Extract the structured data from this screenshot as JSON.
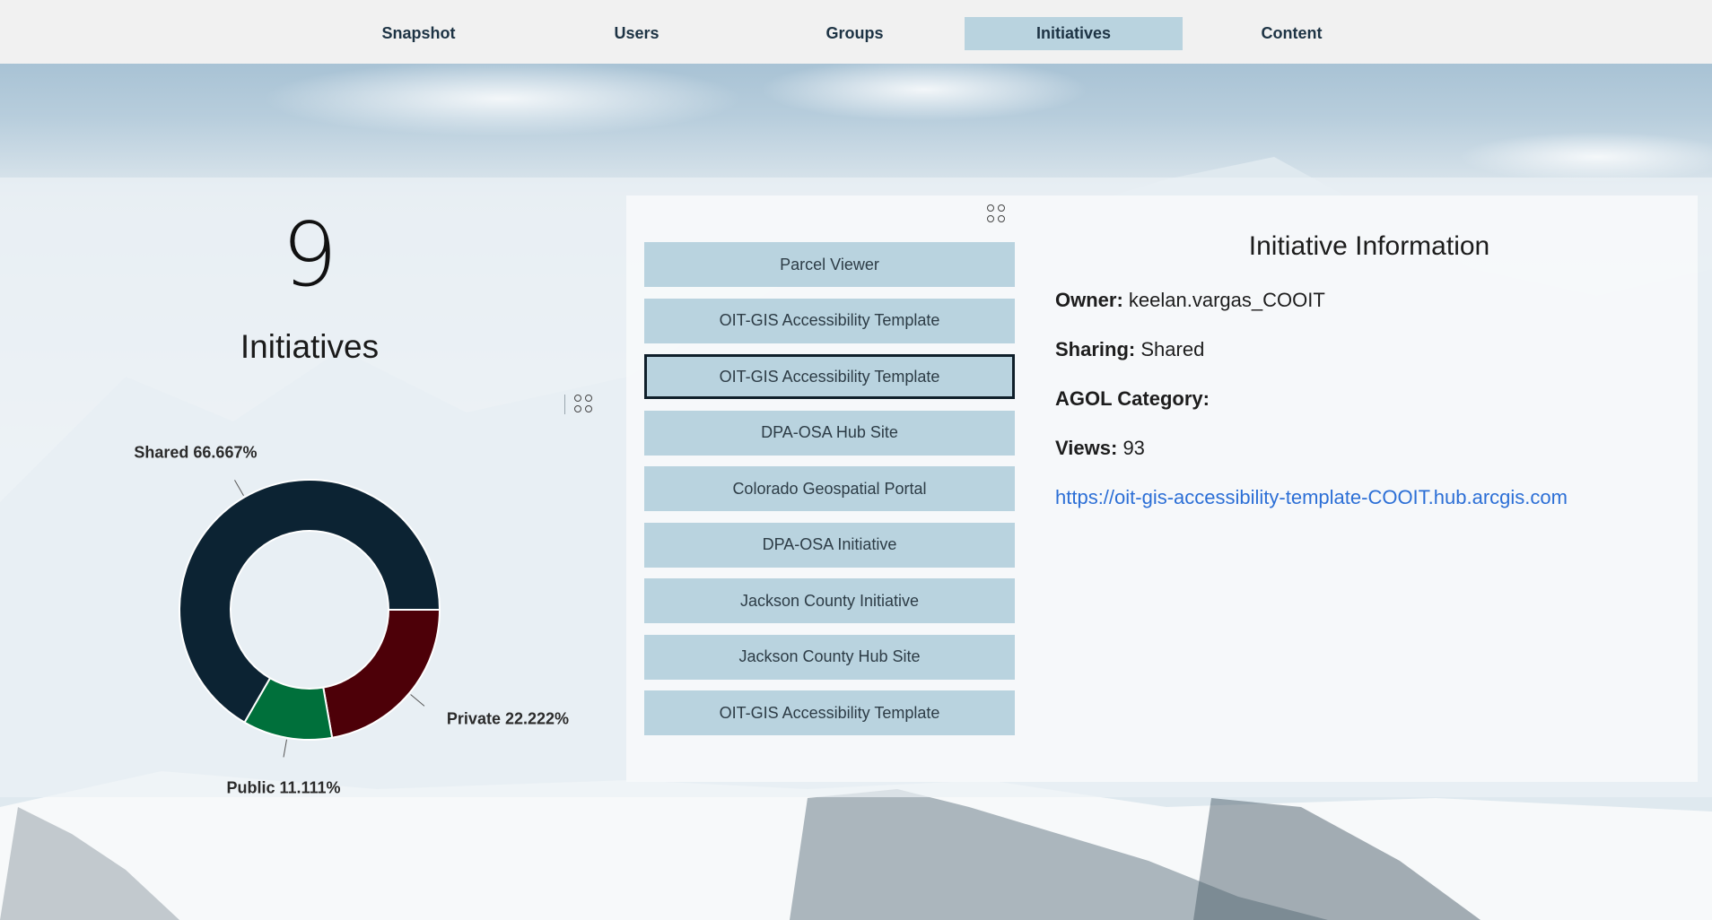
{
  "nav": {
    "items": [
      {
        "label": "Snapshot"
      },
      {
        "label": "Users"
      },
      {
        "label": "Groups"
      },
      {
        "label": "Initiatives"
      },
      {
        "label": "Content"
      }
    ],
    "active": "Initiatives"
  },
  "summary": {
    "count": "9",
    "label": "Initiatives"
  },
  "chart_data": {
    "type": "pie",
    "donut": true,
    "categories": [
      "Shared",
      "Private",
      "Public"
    ],
    "values": [
      66.667,
      22.222,
      11.111
    ],
    "labels": [
      "Shared 66.667%",
      "Private 22.222%",
      "Public 11.111%"
    ],
    "colors": [
      "#0c2333",
      "#4d0008",
      "#00703b"
    ]
  },
  "initiatives": {
    "items": [
      "Parcel Viewer",
      "OIT-GIS Accessibility Template",
      "OIT-GIS Accessibility Template",
      "DPA-OSA Hub Site",
      "Colorado Geospatial Portal",
      "DPA-OSA Initiative",
      "Jackson County Initiative",
      "Jackson County Hub Site",
      "OIT-GIS Accessibility Template"
    ],
    "selected_index": 2
  },
  "info": {
    "title": "Initiative Information",
    "owner_label": "Owner:",
    "owner": "keelan.vargas_COOIT",
    "sharing_label": "Sharing:",
    "sharing": "Shared",
    "category_label": "AGOL Category:",
    "category": "",
    "views_label": "Views:",
    "views": "93",
    "url": "https://oit-gis-accessibility-template-COOIT.hub.arcgis.com"
  }
}
